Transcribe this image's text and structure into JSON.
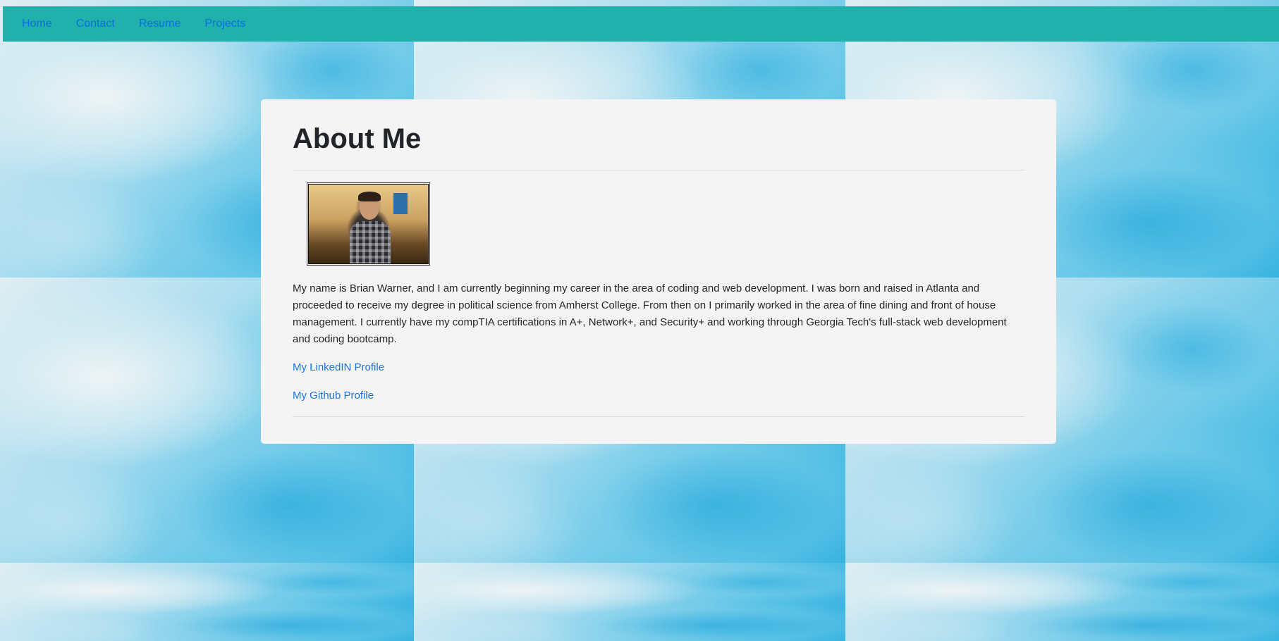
{
  "nav": {
    "items": [
      {
        "label": "Home"
      },
      {
        "label": "Contact"
      },
      {
        "label": "Resume"
      },
      {
        "label": "Projects"
      }
    ]
  },
  "main": {
    "title": "About Me",
    "bio": "My name is Brian Warner, and I am currently beginning my career in the area of coding and web development. I was born and raised in Atlanta and proceeded to receive my degree in political science from Amherst College. From then on I primarily worked in the area of fine dining and front of house management. I currently have my compTIA certifications in A+, Network+, and Security+ and working through Georgia Tech's full-stack web development and coding bootcamp.",
    "links": [
      {
        "label": "My LinkedIN Profile"
      },
      {
        "label": "My Github Profile"
      }
    ]
  },
  "colors": {
    "navbar": "#20b2aa",
    "nav_link": "#0a6ee6",
    "card": "#f4f4f4",
    "link": "#1a73d9",
    "text": "#212529"
  }
}
